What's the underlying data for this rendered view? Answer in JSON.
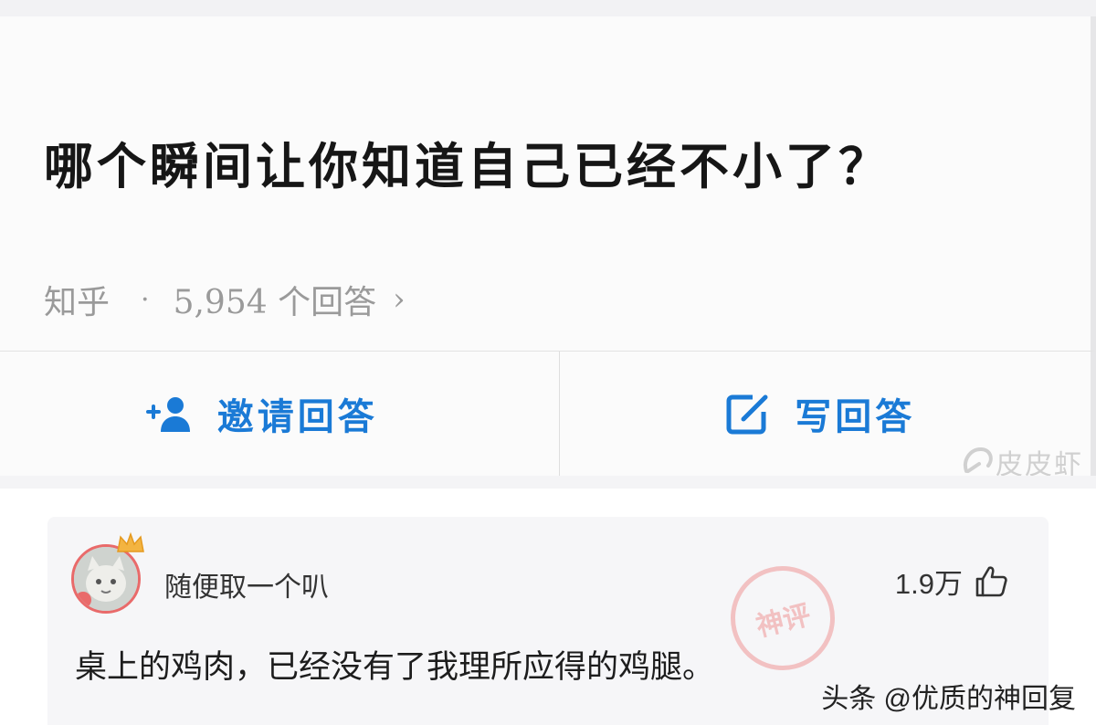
{
  "question": {
    "title": "哪个瞬间让你知道自己已经不小了？",
    "source": "知乎",
    "separator": "·",
    "answer_count": "5,954 个回答",
    "chevron": "›"
  },
  "actions": {
    "invite_label": "邀请回答",
    "write_label": "写回答",
    "accent_color": "#1a7ad6"
  },
  "watermark": {
    "text": "皮皮虾"
  },
  "answer": {
    "username": "随便取一个叭",
    "likes": "1.9万",
    "text": "桌上的鸡肉，已经没有了我理所应得的鸡腿。",
    "stamp_text": "神评"
  },
  "footer": {
    "source_tag": "头条 @优质的神回复"
  }
}
